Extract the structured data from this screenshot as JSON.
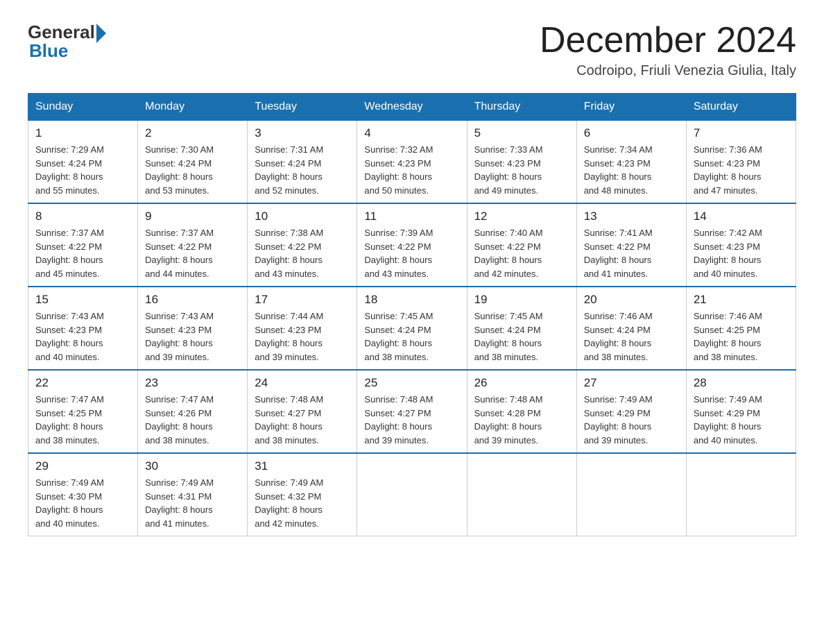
{
  "header": {
    "logo_general": "General",
    "logo_blue": "Blue",
    "month_title": "December 2024",
    "location": "Codroipo, Friuli Venezia Giulia, Italy"
  },
  "days_of_week": [
    "Sunday",
    "Monday",
    "Tuesday",
    "Wednesday",
    "Thursday",
    "Friday",
    "Saturday"
  ],
  "weeks": [
    [
      {
        "day": "1",
        "sunrise": "7:29 AM",
        "sunset": "4:24 PM",
        "daylight": "8 hours and 55 minutes."
      },
      {
        "day": "2",
        "sunrise": "7:30 AM",
        "sunset": "4:24 PM",
        "daylight": "8 hours and 53 minutes."
      },
      {
        "day": "3",
        "sunrise": "7:31 AM",
        "sunset": "4:24 PM",
        "daylight": "8 hours and 52 minutes."
      },
      {
        "day": "4",
        "sunrise": "7:32 AM",
        "sunset": "4:23 PM",
        "daylight": "8 hours and 50 minutes."
      },
      {
        "day": "5",
        "sunrise": "7:33 AM",
        "sunset": "4:23 PM",
        "daylight": "8 hours and 49 minutes."
      },
      {
        "day": "6",
        "sunrise": "7:34 AM",
        "sunset": "4:23 PM",
        "daylight": "8 hours and 48 minutes."
      },
      {
        "day": "7",
        "sunrise": "7:36 AM",
        "sunset": "4:23 PM",
        "daylight": "8 hours and 47 minutes."
      }
    ],
    [
      {
        "day": "8",
        "sunrise": "7:37 AM",
        "sunset": "4:22 PM",
        "daylight": "8 hours and 45 minutes."
      },
      {
        "day": "9",
        "sunrise": "7:37 AM",
        "sunset": "4:22 PM",
        "daylight": "8 hours and 44 minutes."
      },
      {
        "day": "10",
        "sunrise": "7:38 AM",
        "sunset": "4:22 PM",
        "daylight": "8 hours and 43 minutes."
      },
      {
        "day": "11",
        "sunrise": "7:39 AM",
        "sunset": "4:22 PM",
        "daylight": "8 hours and 43 minutes."
      },
      {
        "day": "12",
        "sunrise": "7:40 AM",
        "sunset": "4:22 PM",
        "daylight": "8 hours and 42 minutes."
      },
      {
        "day": "13",
        "sunrise": "7:41 AM",
        "sunset": "4:22 PM",
        "daylight": "8 hours and 41 minutes."
      },
      {
        "day": "14",
        "sunrise": "7:42 AM",
        "sunset": "4:23 PM",
        "daylight": "8 hours and 40 minutes."
      }
    ],
    [
      {
        "day": "15",
        "sunrise": "7:43 AM",
        "sunset": "4:23 PM",
        "daylight": "8 hours and 40 minutes."
      },
      {
        "day": "16",
        "sunrise": "7:43 AM",
        "sunset": "4:23 PM",
        "daylight": "8 hours and 39 minutes."
      },
      {
        "day": "17",
        "sunrise": "7:44 AM",
        "sunset": "4:23 PM",
        "daylight": "8 hours and 39 minutes."
      },
      {
        "day": "18",
        "sunrise": "7:45 AM",
        "sunset": "4:24 PM",
        "daylight": "8 hours and 38 minutes."
      },
      {
        "day": "19",
        "sunrise": "7:45 AM",
        "sunset": "4:24 PM",
        "daylight": "8 hours and 38 minutes."
      },
      {
        "day": "20",
        "sunrise": "7:46 AM",
        "sunset": "4:24 PM",
        "daylight": "8 hours and 38 minutes."
      },
      {
        "day": "21",
        "sunrise": "7:46 AM",
        "sunset": "4:25 PM",
        "daylight": "8 hours and 38 minutes."
      }
    ],
    [
      {
        "day": "22",
        "sunrise": "7:47 AM",
        "sunset": "4:25 PM",
        "daylight": "8 hours and 38 minutes."
      },
      {
        "day": "23",
        "sunrise": "7:47 AM",
        "sunset": "4:26 PM",
        "daylight": "8 hours and 38 minutes."
      },
      {
        "day": "24",
        "sunrise": "7:48 AM",
        "sunset": "4:27 PM",
        "daylight": "8 hours and 38 minutes."
      },
      {
        "day": "25",
        "sunrise": "7:48 AM",
        "sunset": "4:27 PM",
        "daylight": "8 hours and 39 minutes."
      },
      {
        "day": "26",
        "sunrise": "7:48 AM",
        "sunset": "4:28 PM",
        "daylight": "8 hours and 39 minutes."
      },
      {
        "day": "27",
        "sunrise": "7:49 AM",
        "sunset": "4:29 PM",
        "daylight": "8 hours and 39 minutes."
      },
      {
        "day": "28",
        "sunrise": "7:49 AM",
        "sunset": "4:29 PM",
        "daylight": "8 hours and 40 minutes."
      }
    ],
    [
      {
        "day": "29",
        "sunrise": "7:49 AM",
        "sunset": "4:30 PM",
        "daylight": "8 hours and 40 minutes."
      },
      {
        "day": "30",
        "sunrise": "7:49 AM",
        "sunset": "4:31 PM",
        "daylight": "8 hours and 41 minutes."
      },
      {
        "day": "31",
        "sunrise": "7:49 AM",
        "sunset": "4:32 PM",
        "daylight": "8 hours and 42 minutes."
      },
      null,
      null,
      null,
      null
    ]
  ],
  "labels": {
    "sunrise": "Sunrise:",
    "sunset": "Sunset:",
    "daylight": "Daylight:"
  }
}
